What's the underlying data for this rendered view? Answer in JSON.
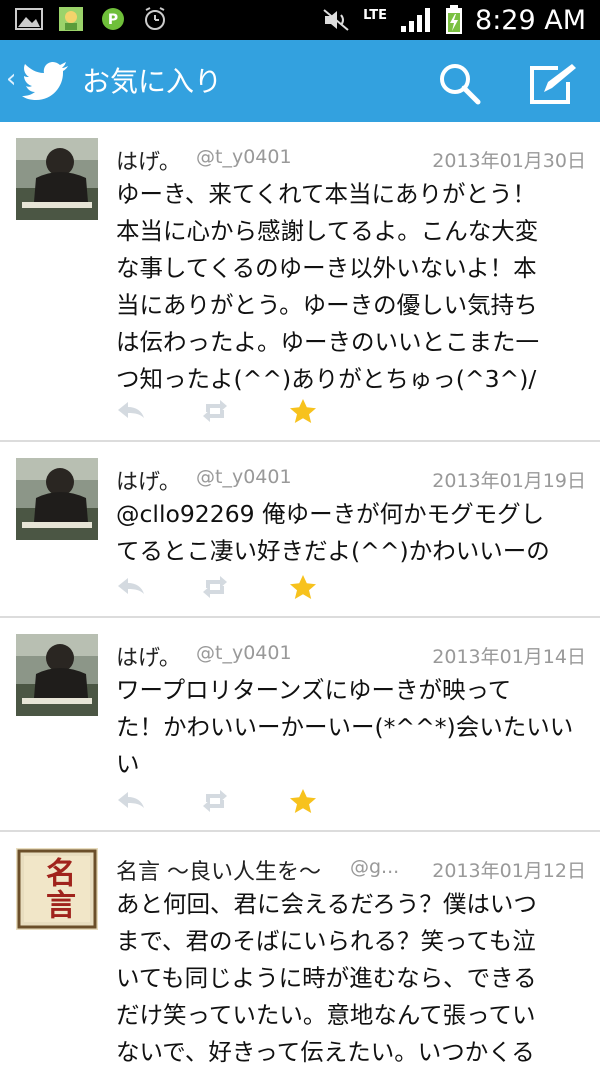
{
  "status_bar": {
    "time": "8:29 AM",
    "network": "LTE"
  },
  "action_bar": {
    "back_glyph": "‹",
    "title": "お気に入り",
    "icons": [
      "twitter-bird-icon",
      "search-icon",
      "compose-icon"
    ],
    "color": "#33a1df"
  },
  "tweets": [
    {
      "name": "はげ。",
      "handle": "@t_y0401",
      "date": "2013年01月30日",
      "lines": [
        "ゆーき、来てくれて本当にありがとう！",
        "本当に心から感謝してるよ。こんな大変",
        "な事してくるのゆーき以外いないよ！本",
        "当にありがとう。ゆーきの優しい気持ち",
        "は伝わったよ。ゆーきのいいとこまた一",
        "つ知ったよ(^^)ありがとちゅっ(^3^)/"
      ],
      "avatar": "photo",
      "favorited": true
    },
    {
      "name": "はげ。",
      "handle": "@t_y0401",
      "date": "2013年01月19日",
      "lines": [
        "@cllo92269 俺ゆーきが何かモグモグし",
        "てるとこ凄い好きだよ(^^)かわいいーの"
      ],
      "avatar": "photo",
      "favorited": true
    },
    {
      "name": "はげ。",
      "handle": "@t_y0401",
      "date": "2013年01月14日",
      "lines": [
        "ワープロリターンズにゆーきが映って",
        "た！かわいいーかーいー(*^^*)会いたいい",
        "い"
      ],
      "avatar": "photo",
      "favorited": true
    },
    {
      "name": "名言 〜良い人生を〜",
      "handle": "@g...",
      "date": "2013年01月12日",
      "lines": [
        "あと何回、君に会えるだろう？僕はいつ",
        "まで、君のそばにいられる？笑っても泣",
        "いても同じように時が進むなら、できる",
        "だけ笑っていたい。意地なんて張ってい",
        "ないで、好きって伝えたい。いつかくる"
      ],
      "avatar": "meigen",
      "avatar_text": "名言",
      "favorited": false
    }
  ]
}
